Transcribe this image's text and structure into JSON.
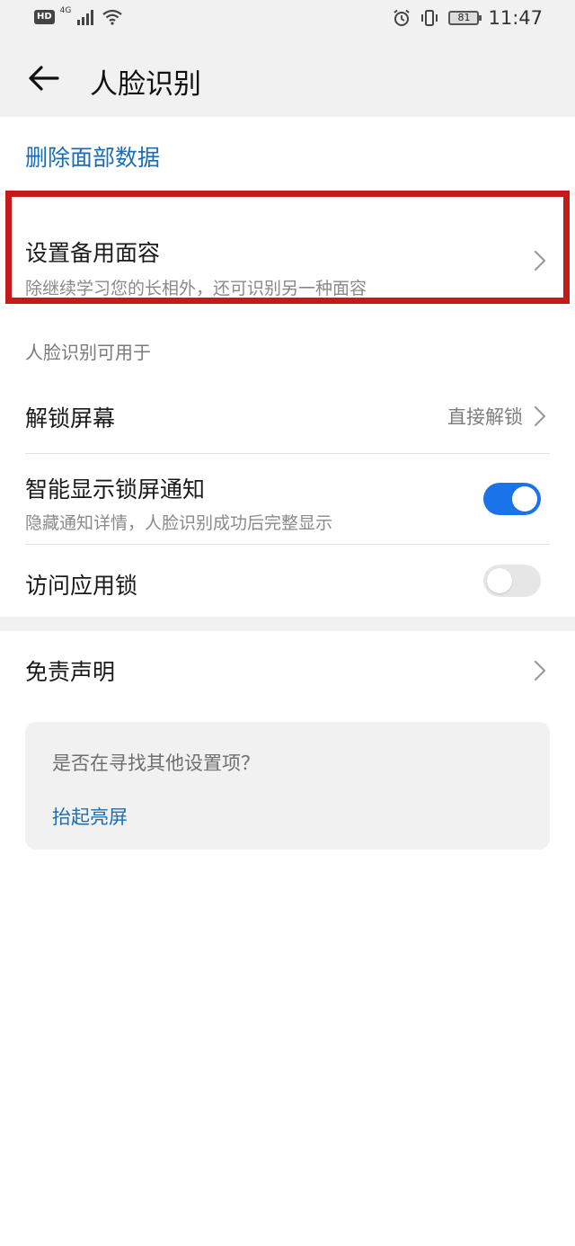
{
  "status_bar": {
    "hd": "HD",
    "network": "4G",
    "battery": "81",
    "time": "11:47"
  },
  "app_bar": {
    "title": "人脸识别"
  },
  "delete_face_data": "删除面部数据",
  "backup_face": {
    "title": "设置备用面容",
    "subtitle": "除继续学习您的长相外，还可识别另一种面容"
  },
  "usage_section": {
    "header": "人脸识别可用于",
    "unlock_screen": {
      "title": "解锁屏幕",
      "value": "直接解锁"
    },
    "smart_notify": {
      "title": "智能显示锁屏通知",
      "subtitle": "隐藏通知详情，人脸识别成功后完整显示",
      "enabled": true
    },
    "app_lock": {
      "title": "访问应用锁",
      "enabled": false
    }
  },
  "disclaimer": "免责声明",
  "suggestions": {
    "question": "是否在寻找其他设置项？",
    "link": "抬起亮屏"
  },
  "colors": {
    "accent": "#1a73e8",
    "link": "#1a6db3",
    "highlight": "#c41a1a"
  }
}
